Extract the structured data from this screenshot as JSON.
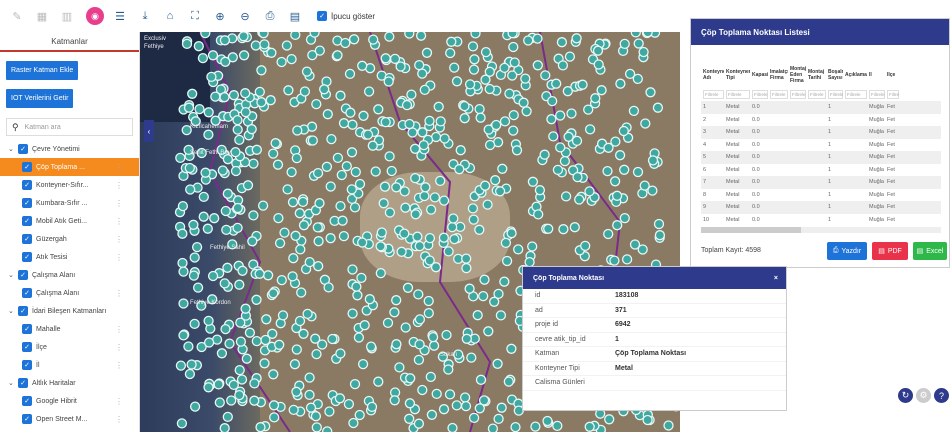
{
  "toolbar": {
    "tooltip_label": "İpucu göster",
    "buttons": [
      "edit-icon",
      "grid-icon",
      "table-icon",
      "layers-active-icon",
      "list-icon",
      "download-icon",
      "home-icon",
      "fullscreen-icon",
      "zoom-in-icon",
      "zoom-out-icon",
      "print-icon",
      "document-icon"
    ]
  },
  "left": {
    "title": "Katmanlar",
    "raster_button": "Raster Katman Ekle",
    "iot_button": "IOT Verilerini Getir",
    "search_placeholder": "Katman ara",
    "tree": [
      {
        "label": "Çevre Yönetimi",
        "level": 0
      },
      {
        "label": "Çöp Toplama ...",
        "level": 1,
        "selected": true
      },
      {
        "label": "Konteyner-Sıfır...",
        "level": 1
      },
      {
        "label": "Kumbara-Sıfır ...",
        "level": 1
      },
      {
        "label": "Mobil Atık Geti...",
        "level": 1
      },
      {
        "label": "Güzergah",
        "level": 1
      },
      {
        "label": "Atık Tesisi",
        "level": 1
      },
      {
        "label": "Çalışma Alanı",
        "level": 0
      },
      {
        "label": "Çalışma Alanı",
        "level": 1
      },
      {
        "label": "İdari Bileşen Katmanları",
        "level": 0
      },
      {
        "label": "Mahalle",
        "level": 1
      },
      {
        "label": "İlçe",
        "level": 1
      },
      {
        "label": "İl",
        "level": 1
      },
      {
        "label": "Altlık Haritalar",
        "level": 0
      },
      {
        "label": "Google Hibrit",
        "level": 1
      },
      {
        "label": "Open Street M...",
        "level": 1
      }
    ]
  },
  "map": {
    "labels": [
      "Exclusiv",
      "Fethiye",
      "Kızılcahemam",
      "Şehit Fethi Bey",
      "Fethiye Sahil",
      "Fethiye Kordon",
      "Sukarı"
    ]
  },
  "table": {
    "title": "Çöp Toplama Noktası Listesi",
    "headers": [
      "Konteyner Adı",
      "Konteyner Tipi",
      "Kapasite",
      "İmalatçı Firma",
      "Montaj Eden Firma",
      "Montaj Tarihi",
      "Boşalma Sayısı",
      "Açıklama",
      "İl",
      "İlçe"
    ],
    "filter_placeholder": "Filtrele",
    "rows": [
      [
        "1",
        "Metal",
        "0.0",
        "",
        "",
        "",
        "1",
        "",
        "Muğla",
        "Fet"
      ],
      [
        "2",
        "Metal",
        "0.0",
        "",
        "",
        "",
        "1",
        "",
        "Muğla",
        "Fet"
      ],
      [
        "3",
        "Metal",
        "0.0",
        "",
        "",
        "",
        "1",
        "",
        "Muğla",
        "Fet"
      ],
      [
        "4",
        "Metal",
        "0.0",
        "",
        "",
        "",
        "1",
        "",
        "Muğla",
        "Fet"
      ],
      [
        "5",
        "Metal",
        "0.0",
        "",
        "",
        "",
        "1",
        "",
        "Muğla",
        "Fet"
      ],
      [
        "6",
        "Metal",
        "0.0",
        "",
        "",
        "",
        "1",
        "",
        "Muğla",
        "Fet"
      ],
      [
        "7",
        "Metal",
        "0.0",
        "",
        "",
        "",
        "1",
        "",
        "Muğla",
        "Fet"
      ],
      [
        "8",
        "Metal",
        "0.0",
        "",
        "",
        "",
        "1",
        "",
        "Muğla",
        "Fet"
      ],
      [
        "9",
        "Metal",
        "0.0",
        "",
        "",
        "",
        "1",
        "",
        "Muğla",
        "Fet"
      ],
      [
        "10",
        "Metal",
        "0.0",
        "",
        "",
        "",
        "1",
        "",
        "Muğla",
        "Fet"
      ]
    ],
    "total": "Toplam Kayıt: 4598",
    "print_label": "Yazdır",
    "pdf_label": "PDF",
    "excel_label": "Excel"
  },
  "popup": {
    "title": "Çöp Toplama Noktası",
    "close": "×",
    "fields": [
      {
        "k": "id",
        "v": "183108"
      },
      {
        "k": "ad",
        "v": "371"
      },
      {
        "k": "proje id",
        "v": "6942"
      },
      {
        "k": "cevre atik_tip_id",
        "v": "1"
      },
      {
        "k": "Katman",
        "v": "Çöp Toplama Noktası"
      },
      {
        "k": "Konteyner Tipi",
        "v": "Metal"
      },
      {
        "k": "Calisma Günleri",
        "v": ""
      }
    ]
  }
}
